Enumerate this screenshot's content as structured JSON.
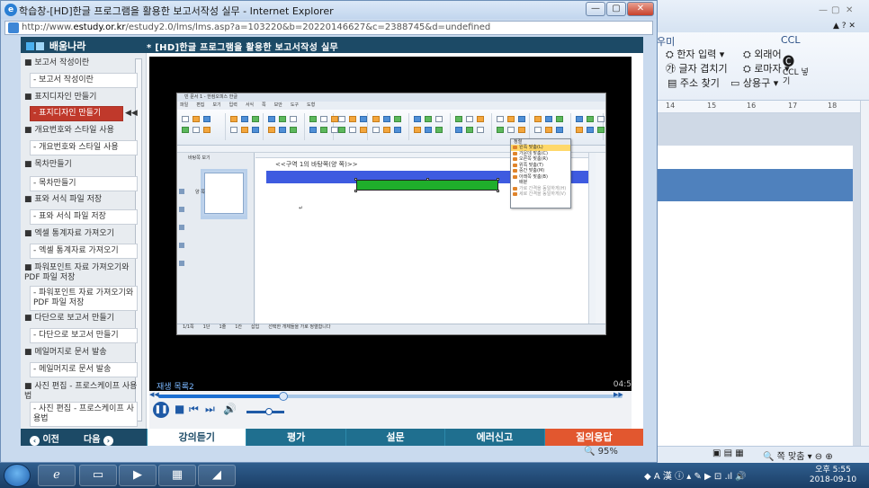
{
  "ie": {
    "title": "학습창-[HD]한글 프로그램을 활용한 보고서작성 실무 - Internet Explorer",
    "url_prefix": "http://www.",
    "url_domain": "estudy.or.kr",
    "url_rest": "/estudy2.0/lms/lms.asp?a=103220&b=202201466​27&c=2388745&d=undefined"
  },
  "header": {
    "brand": "배움나라",
    "course_title": "* [HD]한글 프로그램을 활용한 보고서작성 실무"
  },
  "sidebar": {
    "items": [
      {
        "label": "■ 보고서 작성이란",
        "type": "sec"
      },
      {
        "label": "- 보고서 작성이란",
        "type": "sub"
      },
      {
        "label": "■ 표지디자인 만들기",
        "type": "sec"
      },
      {
        "label": "- 표지디자인 만들기",
        "type": "current"
      },
      {
        "label": "■ 개요번호와 스타일 사용",
        "type": "sec"
      },
      {
        "label": "- 개요번호와 스타일 사용",
        "type": "sub"
      },
      {
        "label": "■ 목차만들기",
        "type": "sec"
      },
      {
        "label": "- 목차만들기",
        "type": "sub"
      },
      {
        "label": "■ 표와 서식 파일 저장",
        "type": "sec"
      },
      {
        "label": "- 표와 서식 파일 저장",
        "type": "sub"
      },
      {
        "label": "■ 엑셀 통계자료 가져오기",
        "type": "sec"
      },
      {
        "label": "- 엑셀 통계자료 가져오기",
        "type": "sub"
      },
      {
        "label": "■ 파워포인트 자료 가져오기와 PDF 파일 저장",
        "type": "sec"
      },
      {
        "label": "- 파워포인트 자료 가져오기와 PDF 파일 저장",
        "type": "sub"
      },
      {
        "label": "■ 다단으로 보고서 만들기",
        "type": "sec"
      },
      {
        "label": "- 다단으로 보고서 만들기",
        "type": "sub"
      },
      {
        "label": "■ 메일머지로 문서 발송",
        "type": "sec"
      },
      {
        "label": "- 메일머지로 문서 발송",
        "type": "sub"
      },
      {
        "label": "■ 사진 편집 - 프로스케이프 사용법",
        "type": "sec"
      },
      {
        "label": "- 사진 편집 - 프로스케이프 사용법",
        "type": "sub"
      }
    ],
    "current_marker": "◀◀"
  },
  "video": {
    "caption_left": "재생 목록2",
    "caption_right": "04:5",
    "progress": 0.27,
    "volume": 0.6,
    "hwp": {
      "title": "빈 문서 1 - 한컴오피스 한글",
      "menu": [
        "파일",
        "편집",
        "보기",
        "입력",
        "서식",
        "쪽",
        "보안",
        "도구",
        "도형"
      ],
      "slide_title": "<<구역 1의 바탕쪽(양 쪽)>>",
      "left_pane_title": "바탕쪽 보기",
      "left_pane_label": "양 쪽",
      "status_items": [
        "1/1쪽",
        "1단",
        "1줄",
        "1칸",
        "삽입",
        "선택한 개체들을 가로 정렬합니다"
      ],
      "dropdown": {
        "header": "정렬",
        "items": [
          {
            "label": "왼쪽 맞춤(L)",
            "state": "hi"
          },
          {
            "label": "가운데 맞춤(C)",
            "state": ""
          },
          {
            "label": "오른쪽 맞춤(R)",
            "state": ""
          },
          {
            "label": "위쪽 맞춤(T)",
            "state": ""
          },
          {
            "label": "중간 맞춤(M)",
            "state": ""
          },
          {
            "label": "아래쪽 맞춤(B)",
            "state": ""
          },
          {
            "label": "배분",
            "state": "nomark"
          },
          {
            "label": "가로 간격을 동일하게(H)",
            "state": "dim"
          },
          {
            "label": "세로 간격을 동일하게(V)",
            "state": "dim"
          }
        ]
      }
    }
  },
  "nav": {
    "prev": "이전",
    "next": "다음"
  },
  "tabs": [
    {
      "label": "강의듣기",
      "state": "active"
    },
    {
      "label": "평가",
      "state": ""
    },
    {
      "label": "설문",
      "state": ""
    },
    {
      "label": "에러신고",
      "state": ""
    },
    {
      "label": "질의응답",
      "state": "qa"
    }
  ],
  "zoom": "🔍 95%",
  "bg_app": {
    "ribbon": {
      "item1": "우미",
      "item2": "한자 입력",
      "item3": "외래어",
      "item4": "글자 겹치기",
      "item5": "로마자",
      "item6": "주소 찾기",
      "item7": "상용구",
      "ccl": "CCL",
      "ccl2": "CCL 넣기"
    },
    "ruler": [
      "14",
      "15",
      "16",
      "17",
      "18"
    ],
    "status": "쪽 맞춤"
  },
  "taskbar": {
    "tray": "A 漢",
    "time": "오후 5:55",
    "date": "2018-09-10"
  },
  "colors": {
    "accent": "#1c4a66",
    "current_item": "#c0392b",
    "qa_tab": "#e2572f"
  }
}
